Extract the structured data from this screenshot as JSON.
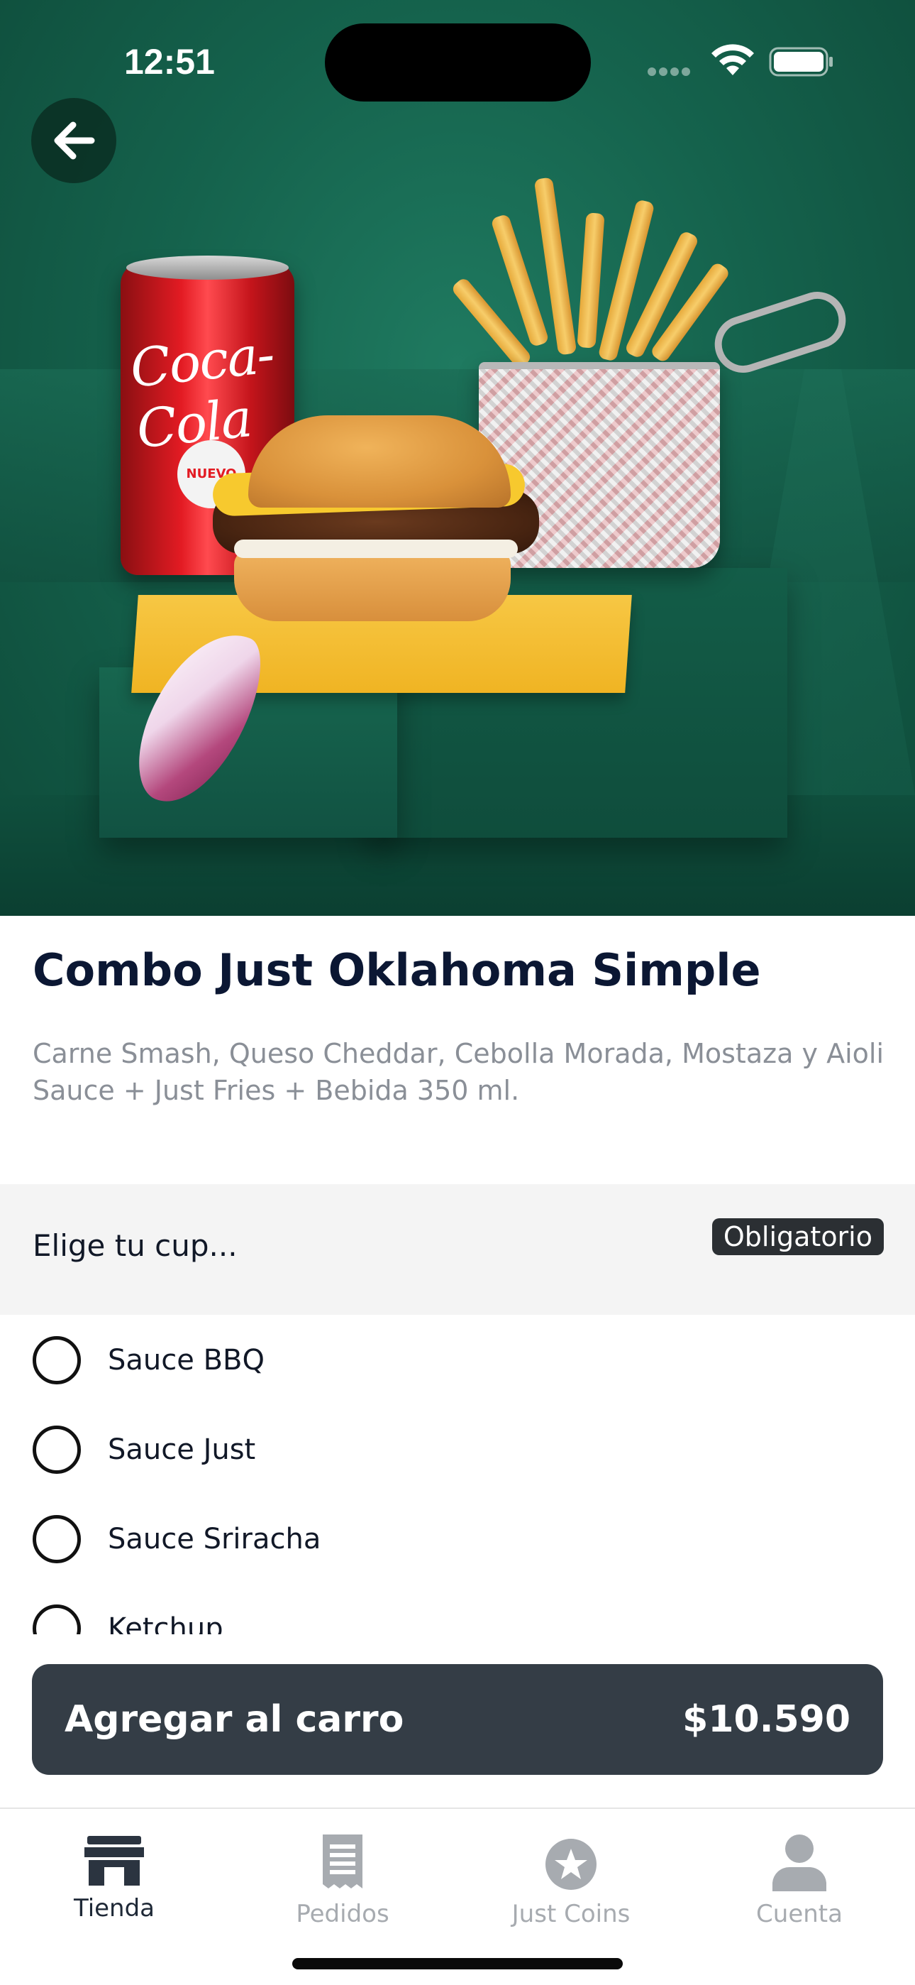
{
  "status_bar": {
    "time": "12:51"
  },
  "hero": {
    "can_text": "Coca-Cola",
    "can_badge": "NUEVO"
  },
  "product": {
    "title": "Combo Just Oklahoma Simple",
    "description": "Carne Smash, Queso Cheddar, Cebolla Morada, Mostaza y Aioli Sauce + Just Fries + Bebida 350 ml."
  },
  "section": {
    "label": "Elige tu cup...",
    "badge": "Obligatorio"
  },
  "options": [
    {
      "label": "Sauce BBQ"
    },
    {
      "label": "Sauce Just"
    },
    {
      "label": "Sauce Sriracha"
    },
    {
      "label": "Ketchup"
    }
  ],
  "cart": {
    "label": "Agregar al carro",
    "price": "$10.590"
  },
  "tabs": [
    {
      "label": "Tienda",
      "icon": "store-icon",
      "active": true
    },
    {
      "label": "Pedidos",
      "icon": "receipt-icon",
      "active": false
    },
    {
      "label": "Just Coins",
      "icon": "star-coin-icon",
      "active": false
    },
    {
      "label": "Cuenta",
      "icon": "person-icon",
      "active": false
    }
  ],
  "colors": {
    "hero_green": "#15634d",
    "title": "#0b1733",
    "cart_button": "#343d46",
    "tab_active": "#2b3440",
    "tab_inactive": "#a7abb0"
  }
}
